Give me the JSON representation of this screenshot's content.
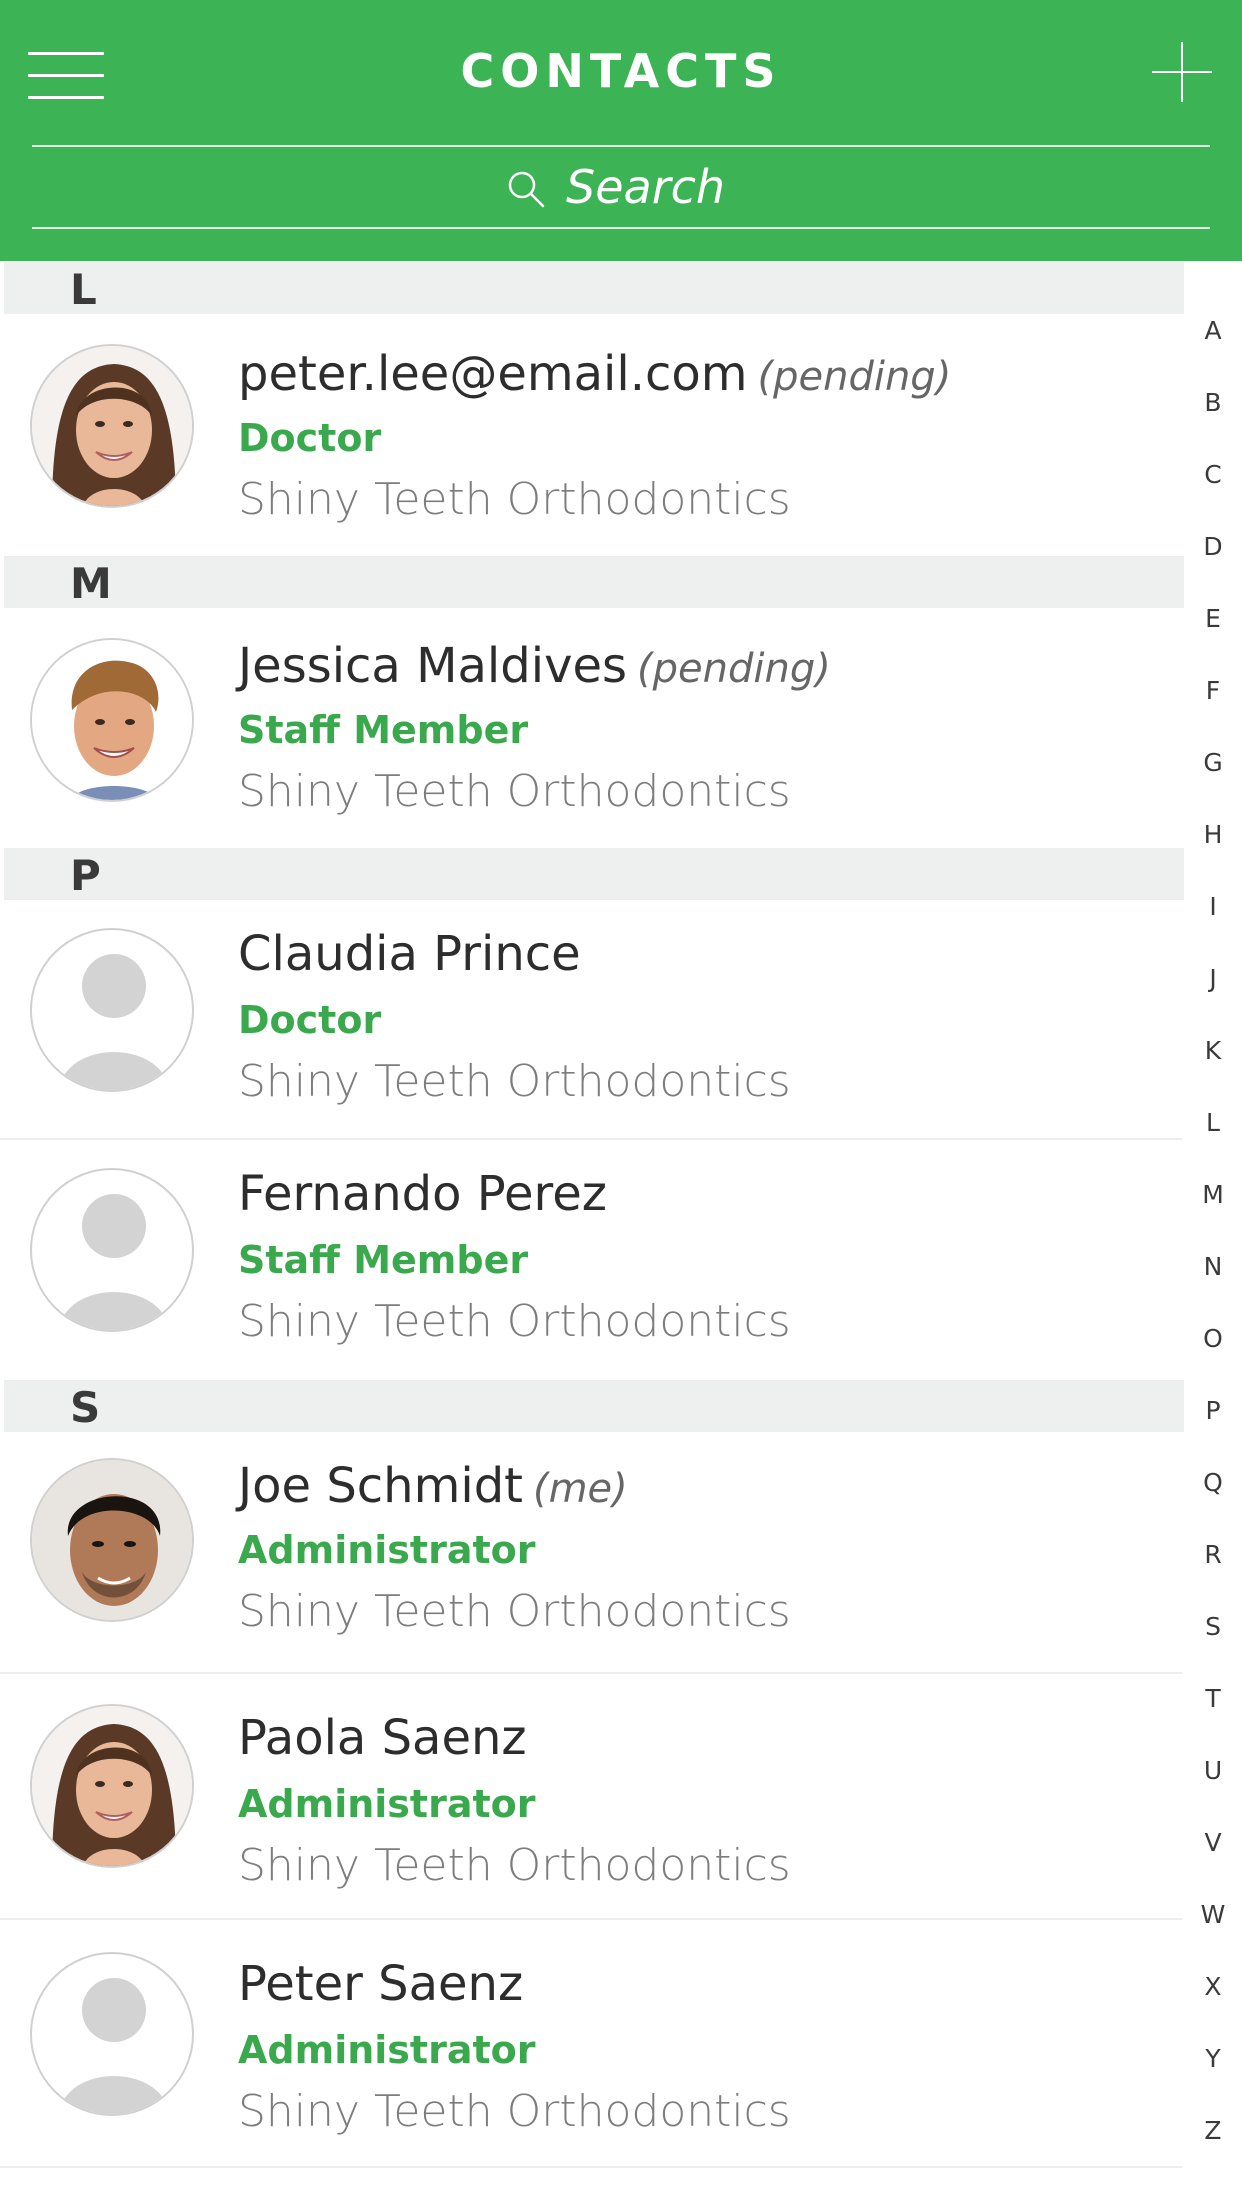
{
  "header": {
    "title": "CONTACTS",
    "search_placeholder": "Search"
  },
  "colors": {
    "accent": "#3cb355",
    "role": "#3aa84c",
    "section_bg": "#eef0ef"
  },
  "sections": [
    {
      "letter": "L"
    },
    {
      "letter": "M"
    },
    {
      "letter": "P"
    },
    {
      "letter": "S"
    }
  ],
  "contacts": [
    {
      "name": "peter.lee@email.com",
      "tag": "(pending)",
      "role": "Doctor",
      "company": "Shiny Teeth Orthodontics",
      "avatar": "woman-photo"
    },
    {
      "name": "Jessica Maldives",
      "tag": "(pending)",
      "role": "Staff Member",
      "company": "Shiny Teeth Orthodontics",
      "avatar": "man-blond-photo"
    },
    {
      "name": "Claudia Prince",
      "tag": "",
      "role": "Doctor",
      "company": "Shiny Teeth Orthodontics",
      "avatar": "placeholder"
    },
    {
      "name": "Fernando Perez",
      "tag": "",
      "role": "Staff Member",
      "company": "Shiny Teeth Orthodontics",
      "avatar": "placeholder"
    },
    {
      "name": "Joe Schmidt",
      "tag": "(me)",
      "role": "Administrator",
      "company": "Shiny Teeth Orthodontics",
      "avatar": "man-dark-photo"
    },
    {
      "name": "Paola Saenz",
      "tag": "",
      "role": "Administrator",
      "company": "Shiny Teeth Orthodontics",
      "avatar": "woman-photo"
    },
    {
      "name": "Peter Saenz",
      "tag": "",
      "role": "Administrator",
      "company": "Shiny Teeth Orthodontics",
      "avatar": "placeholder"
    }
  ],
  "alphabet": [
    "A",
    "B",
    "C",
    "D",
    "E",
    "F",
    "G",
    "H",
    "I",
    "J",
    "K",
    "L",
    "M",
    "N",
    "O",
    "P",
    "Q",
    "R",
    "S",
    "T",
    "U",
    "V",
    "W",
    "X",
    "Y",
    "Z"
  ]
}
